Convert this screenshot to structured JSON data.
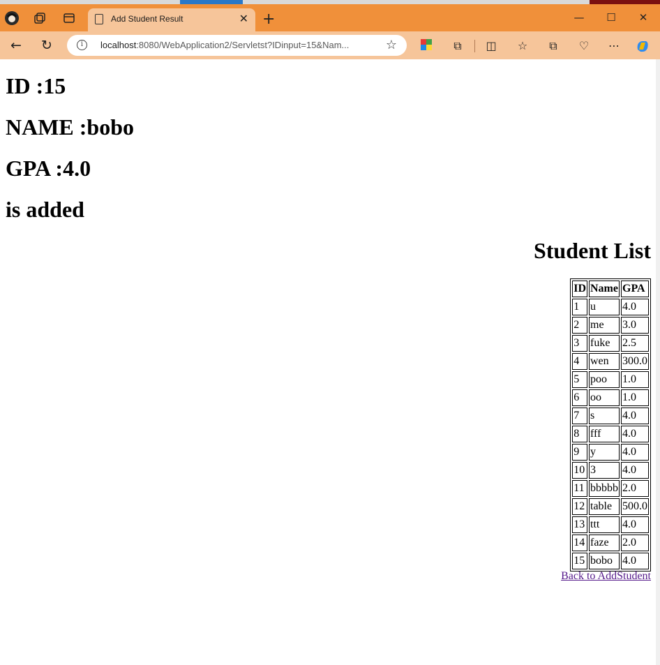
{
  "browser": {
    "tab_title": "Add Student Result",
    "url_host": "localhost",
    "url_rest": ":8080/WebApplication2/Servletst?IDinput=15&Nam...",
    "window_controls": [
      "minimize-icon",
      "maximize-icon",
      "close-icon"
    ],
    "colors": {
      "titlebar": "#f0903a",
      "tab_active": "#f6c59a"
    }
  },
  "result": {
    "id_line": "ID :15",
    "name_line": "NAME :bobo",
    "gpa_line": "GPA :4.0",
    "status_line": "is added"
  },
  "student_list": {
    "title": "Student List",
    "headers": [
      "ID",
      "Name",
      "GPA"
    ],
    "rows": [
      [
        "1",
        "u",
        "4.0"
      ],
      [
        "2",
        "me",
        "3.0"
      ],
      [
        "3",
        "fuke",
        "2.5"
      ],
      [
        "4",
        "wen",
        "300.0"
      ],
      [
        "5",
        "poo",
        "1.0"
      ],
      [
        "6",
        "oo",
        "1.0"
      ],
      [
        "7",
        "s",
        "4.0"
      ],
      [
        "8",
        "fff",
        "4.0"
      ],
      [
        "9",
        "y",
        "4.0"
      ],
      [
        "10",
        "3",
        "4.0"
      ],
      [
        "11",
        "bbbbb",
        "2.0"
      ],
      [
        "12",
        "table",
        "500.0"
      ],
      [
        "13",
        "ttt",
        "4.0"
      ],
      [
        "14",
        "faze",
        "2.0"
      ],
      [
        "15",
        "bobo",
        "4.0"
      ]
    ]
  },
  "back_link": "Back to AddStudent"
}
